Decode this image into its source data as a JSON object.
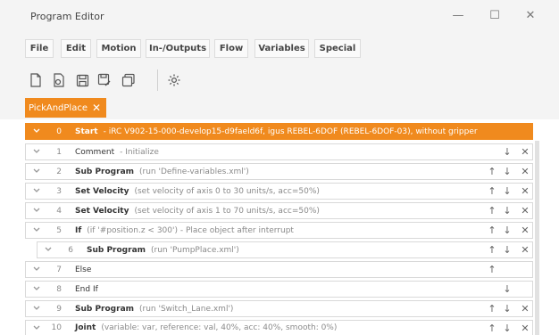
{
  "window": {
    "title": "Program Editor",
    "controls": {
      "minimize": "—",
      "maximize": "☐",
      "close": "✕"
    }
  },
  "menu": [
    "File",
    "Edit",
    "Motion",
    "In-/Outputs",
    "Flow",
    "Variables",
    "Special"
  ],
  "toolbar": {
    "icons": [
      "new-file-icon",
      "open-file-icon",
      "save-icon",
      "save-as-icon",
      "copy-icon",
      "settings-icon"
    ]
  },
  "tab": {
    "label": "PickAndPlace",
    "close": "✕"
  },
  "rows": [
    {
      "num": "0",
      "cmd": "Start",
      "detail": "- iRC V902-15-000-develop15-d9faeld6f, igus REBEL-6DOF (REBEL-6DOF-03), without gripper",
      "selected": true
    },
    {
      "num": "1",
      "cmd": "Comment",
      "detail": "-  Initialize"
    },
    {
      "num": "2",
      "cmd": "Sub Program",
      "detail": "(run 'Define-variables.xml')"
    },
    {
      "num": "3",
      "cmd": "Set Velocity",
      "detail": "(set velocity of axis 0 to 30 units/s, acc=50%)"
    },
    {
      "num": "4",
      "cmd": "Set Velocity",
      "detail": "(set velocity of axis 1 to 70 units/s, acc=50%)"
    },
    {
      "num": "5",
      "cmd": "If",
      "detail": "(if '#position.z < 300') - Place object after interrupt"
    },
    {
      "num": "6",
      "cmd": "Sub Program",
      "detail": "(run 'PumpPlace.xml')"
    },
    {
      "num": "7",
      "cmd": "Else",
      "detail": ""
    },
    {
      "num": "8",
      "cmd": "End If",
      "detail": ""
    },
    {
      "num": "9",
      "cmd": "Sub Program",
      "detail": "(run 'Switch_Lane.xml')"
    },
    {
      "num": "10",
      "cmd": "Joint",
      "detail": "(variable: var, reference: val, 40%, acc: 40%, smooth: 0%)"
    }
  ],
  "icons": {
    "up": "↑",
    "down": "↓",
    "remove": "✕"
  },
  "colors": {
    "accent": "#f08a1e",
    "background": "#f4f4f4"
  }
}
